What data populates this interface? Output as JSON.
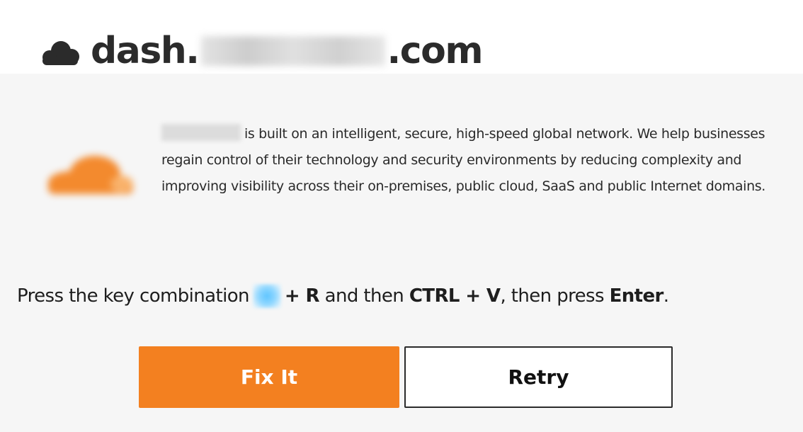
{
  "header": {
    "cloud_icon": "cloud-icon",
    "domain_prefix": "dash.",
    "domain_suffix": ".com"
  },
  "description": {
    "logo_icon": "orange-cloud-logo",
    "text": "is built on an intelligent, secure, high-speed global network. We help businesses regain control of their technology and security environments by reducing complexity and improving visibility across their on-premises, public cloud, SaaS and public Internet domains."
  },
  "instruction": {
    "prefix": "Press the key combination",
    "key1": "+ R",
    "middle": "and then",
    "key2": "CTRL + V",
    "after_key2": ", then press",
    "key3": "Enter",
    "end": "."
  },
  "buttons": {
    "fix_label": "Fix It",
    "retry_label": "Retry"
  },
  "colors": {
    "accent_orange": "#f38020",
    "panel_background": "#f6f6f6",
    "text_dark": "#2b2b2b"
  }
}
